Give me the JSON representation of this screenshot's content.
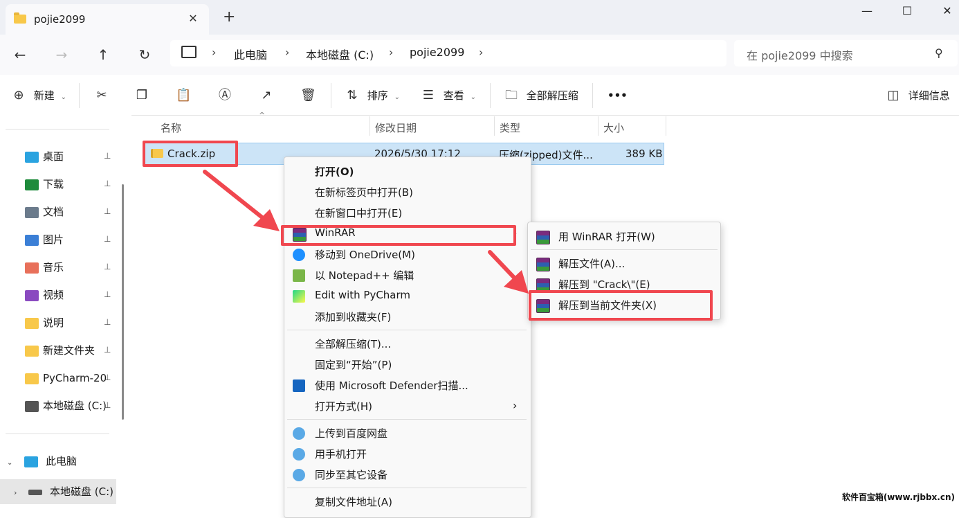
{
  "tab": {
    "title": "pojie2099",
    "close": "✕",
    "add": "+"
  },
  "window_controls": {
    "minimize": "—",
    "maximize": "☐",
    "close": "✕"
  },
  "nav": {
    "back": "←",
    "forward": "→",
    "up": "↑",
    "refresh": "↻",
    "breadcrumb": [
      "此电脑",
      "本地磁盘 (C:)",
      "pojie2099"
    ],
    "sep": "›",
    "search_placeholder": "在 pojie2099 中搜索"
  },
  "toolbar": {
    "new": "新建",
    "sort": "排序",
    "view": "查看",
    "extract_all": "全部解压缩",
    "more": "•••",
    "details": "详细信息"
  },
  "sidebar": {
    "quick": [
      {
        "label": "桌面",
        "color": "#2aa3e0"
      },
      {
        "label": "下载",
        "color": "#1e8b3b"
      },
      {
        "label": "文档",
        "color": "#6b7b8c"
      },
      {
        "label": "图片",
        "color": "#3b7fd6"
      },
      {
        "label": "音乐",
        "color": "#e8705a"
      },
      {
        "label": "视频",
        "color": "#8a4ac0"
      },
      {
        "label": "说明",
        "color": "#f8c84a"
      },
      {
        "label": "新建文件夹",
        "color": "#f8c84a"
      },
      {
        "label": "PyCharm-20",
        "color": "#f8c84a"
      },
      {
        "label": "本地磁盘 (C:)",
        "color": "#555555"
      }
    ],
    "this_pc": "此电脑",
    "local_disk": "本地磁盘 (C:)",
    "pin": "📌"
  },
  "columns": {
    "name": "名称",
    "modified": "修改日期",
    "type": "类型",
    "size": "大小"
  },
  "file": {
    "name": "Crack.zip",
    "modified": "2026/5/30 17:12",
    "type": "压缩(zipped)文件...",
    "size": "389 KB"
  },
  "context_menu": {
    "items": [
      {
        "label": "打开(O)",
        "bold": true
      },
      {
        "label": "在新标签页中打开(B)"
      },
      {
        "label": "在新窗口中打开(E)"
      },
      {
        "label": "WinRAR",
        "icon": "winrar",
        "submenu": true
      },
      {
        "label": "移动到 OneDrive(M)",
        "icon": "onedrive"
      },
      {
        "label": "以 Notepad++ 编辑",
        "icon": "notepad"
      },
      {
        "label": "Edit with PyCharm",
        "icon": "pycharm"
      },
      {
        "label": "添加到收藏夹(F)"
      },
      {
        "label": "全部解压缩(T)..."
      },
      {
        "label": "固定到“开始”(P)"
      },
      {
        "label": "使用 Microsoft Defender扫描...",
        "icon": "defender"
      },
      {
        "label": "打开方式(H)",
        "submenu": true
      },
      {
        "label": "上传到百度网盘",
        "icon": "baidu"
      },
      {
        "label": "用手机打开",
        "icon": "baidu"
      },
      {
        "label": "同步至其它设备",
        "icon": "baidu"
      },
      {
        "label": "复制文件地址(A)"
      }
    ],
    "arrow": "›"
  },
  "winrar_submenu": {
    "items": [
      "用 WinRAR 打开(W)",
      "解压文件(A)...",
      "解压到 \"Crack\\\"(E)",
      "解压到当前文件夹(X)"
    ]
  },
  "watermark": "软件百宝箱(www.rjbbx.cn)",
  "colors": {
    "highlight": "#f0474f",
    "selection": "#cce4f7",
    "accent": "#0067c0"
  }
}
